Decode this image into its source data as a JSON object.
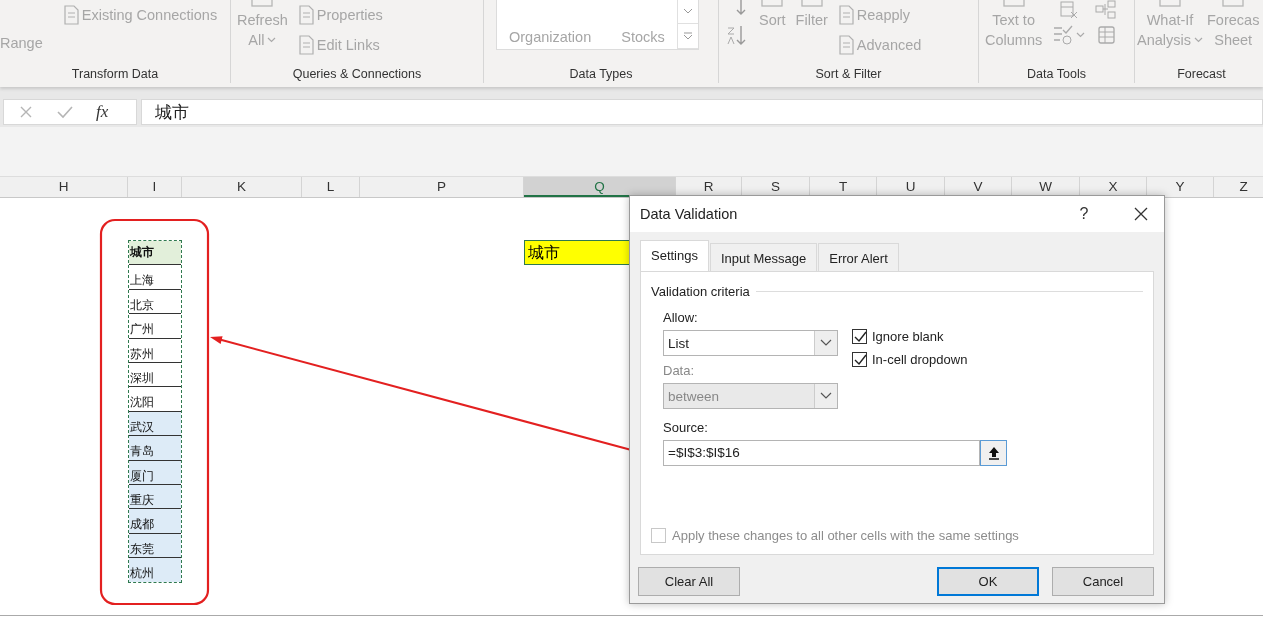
{
  "ribbon": {
    "groups": [
      {
        "label": "Transform Data",
        "columns": [
          {
            "kind": "stack",
            "items": [
              {
                "kind": "label",
                "label": "Range"
              }
            ]
          },
          {
            "kind": "stack",
            "items": [
              {
                "kind": "icon_label",
                "label": "Existing Connections"
              }
            ]
          }
        ]
      },
      {
        "label": "Queries & Connections",
        "columns": [
          {
            "kind": "large",
            "lines": [
              "Refresh",
              "All"
            ],
            "caret": true
          },
          {
            "kind": "stack",
            "items": [
              {
                "kind": "icon_label",
                "label": "Properties"
              },
              {
                "kind": "icon_label",
                "label": "Edit Links"
              }
            ]
          }
        ]
      },
      {
        "label": "Data Types",
        "columns": [
          {
            "kind": "gallery",
            "items": [
              "Organization",
              "Stocks"
            ]
          }
        ]
      },
      {
        "label": "Sort & Filter",
        "columns": [
          {
            "kind": "sort_icons"
          },
          {
            "kind": "large",
            "lines": [
              "Sort"
            ],
            "caret": false
          },
          {
            "kind": "large",
            "lines": [
              "Filter"
            ],
            "caret": false
          },
          {
            "kind": "stack",
            "items": [
              {
                "kind": "icon_label",
                "label": "Reapply"
              },
              {
                "kind": "icon_label",
                "label": "Advanced"
              }
            ]
          }
        ]
      },
      {
        "label": "Data Tools",
        "columns": [
          {
            "kind": "large",
            "lines": [
              "Text to",
              "Columns"
            ],
            "caret": false
          },
          {
            "kind": "tool_icons"
          }
        ]
      },
      {
        "label": "Forecast",
        "columns": [
          {
            "kind": "large",
            "lines": [
              "What-If",
              "Analysis"
            ],
            "caret": true
          },
          {
            "kind": "large",
            "lines": [
              "Forecas",
              "Sheet"
            ],
            "caret": false
          }
        ]
      }
    ]
  },
  "formula_bar": {
    "function_label": "fx",
    "value": "城市"
  },
  "columns": [
    {
      "label": "H",
      "selected": false
    },
    {
      "label": "I",
      "selected": false
    },
    {
      "label": "K",
      "selected": false
    },
    {
      "label": "L",
      "selected": false
    },
    {
      "label": "P",
      "selected": false
    },
    {
      "label": "Q",
      "selected": true
    },
    {
      "label": "R",
      "selected": false
    },
    {
      "label": "S",
      "selected": false
    },
    {
      "label": "T",
      "selected": false
    },
    {
      "label": "U",
      "selected": false
    },
    {
      "label": "V",
      "selected": false
    },
    {
      "label": "W",
      "selected": false
    },
    {
      "label": "X",
      "selected": false
    },
    {
      "label": "Y",
      "selected": false
    },
    {
      "label": "Z",
      "selected": false
    }
  ],
  "list_cells": [
    {
      "text": "城市",
      "kind": "header"
    },
    {
      "text": "上海",
      "kind": "plain"
    },
    {
      "text": "北京",
      "kind": "plain"
    },
    {
      "text": "广州",
      "kind": "plain"
    },
    {
      "text": "苏州",
      "kind": "plain"
    },
    {
      "text": "深圳",
      "kind": "plain"
    },
    {
      "text": "沈阳",
      "kind": "plain"
    },
    {
      "text": "武汉",
      "kind": "shaded"
    },
    {
      "text": "青岛",
      "kind": "shaded"
    },
    {
      "text": "厦门",
      "kind": "shaded"
    },
    {
      "text": "重庆",
      "kind": "shaded"
    },
    {
      "text": "成都",
      "kind": "shaded"
    },
    {
      "text": "东莞",
      "kind": "shaded"
    },
    {
      "text": "杭州",
      "kind": "shaded"
    }
  ],
  "target_cell": {
    "text": "城市"
  },
  "dialog": {
    "title": "Data Validation",
    "help": "?",
    "tabs": [
      {
        "label": "Settings",
        "selected": true
      },
      {
        "label": "Input Message",
        "selected": false
      },
      {
        "label": "Error Alert",
        "selected": false
      }
    ],
    "section_title": "Validation criteria",
    "allow": {
      "label": "Allow:",
      "value": "List",
      "disabled": false
    },
    "data": {
      "label": "Data:",
      "value": "between",
      "disabled": true
    },
    "checkboxes": [
      {
        "label": "Ignore blank",
        "checked": true
      },
      {
        "label": "In-cell dropdown",
        "checked": true
      }
    ],
    "source": {
      "label": "Source:",
      "value": "=$I$3:$I$16"
    },
    "apply_all": {
      "label": "Apply these changes to all other cells with the same settings",
      "checked": false,
      "disabled": true
    },
    "buttons": [
      {
        "label": "Clear All",
        "default": false
      },
      {
        "label": "OK",
        "default": true
      },
      {
        "label": "Cancel",
        "default": false
      }
    ]
  }
}
